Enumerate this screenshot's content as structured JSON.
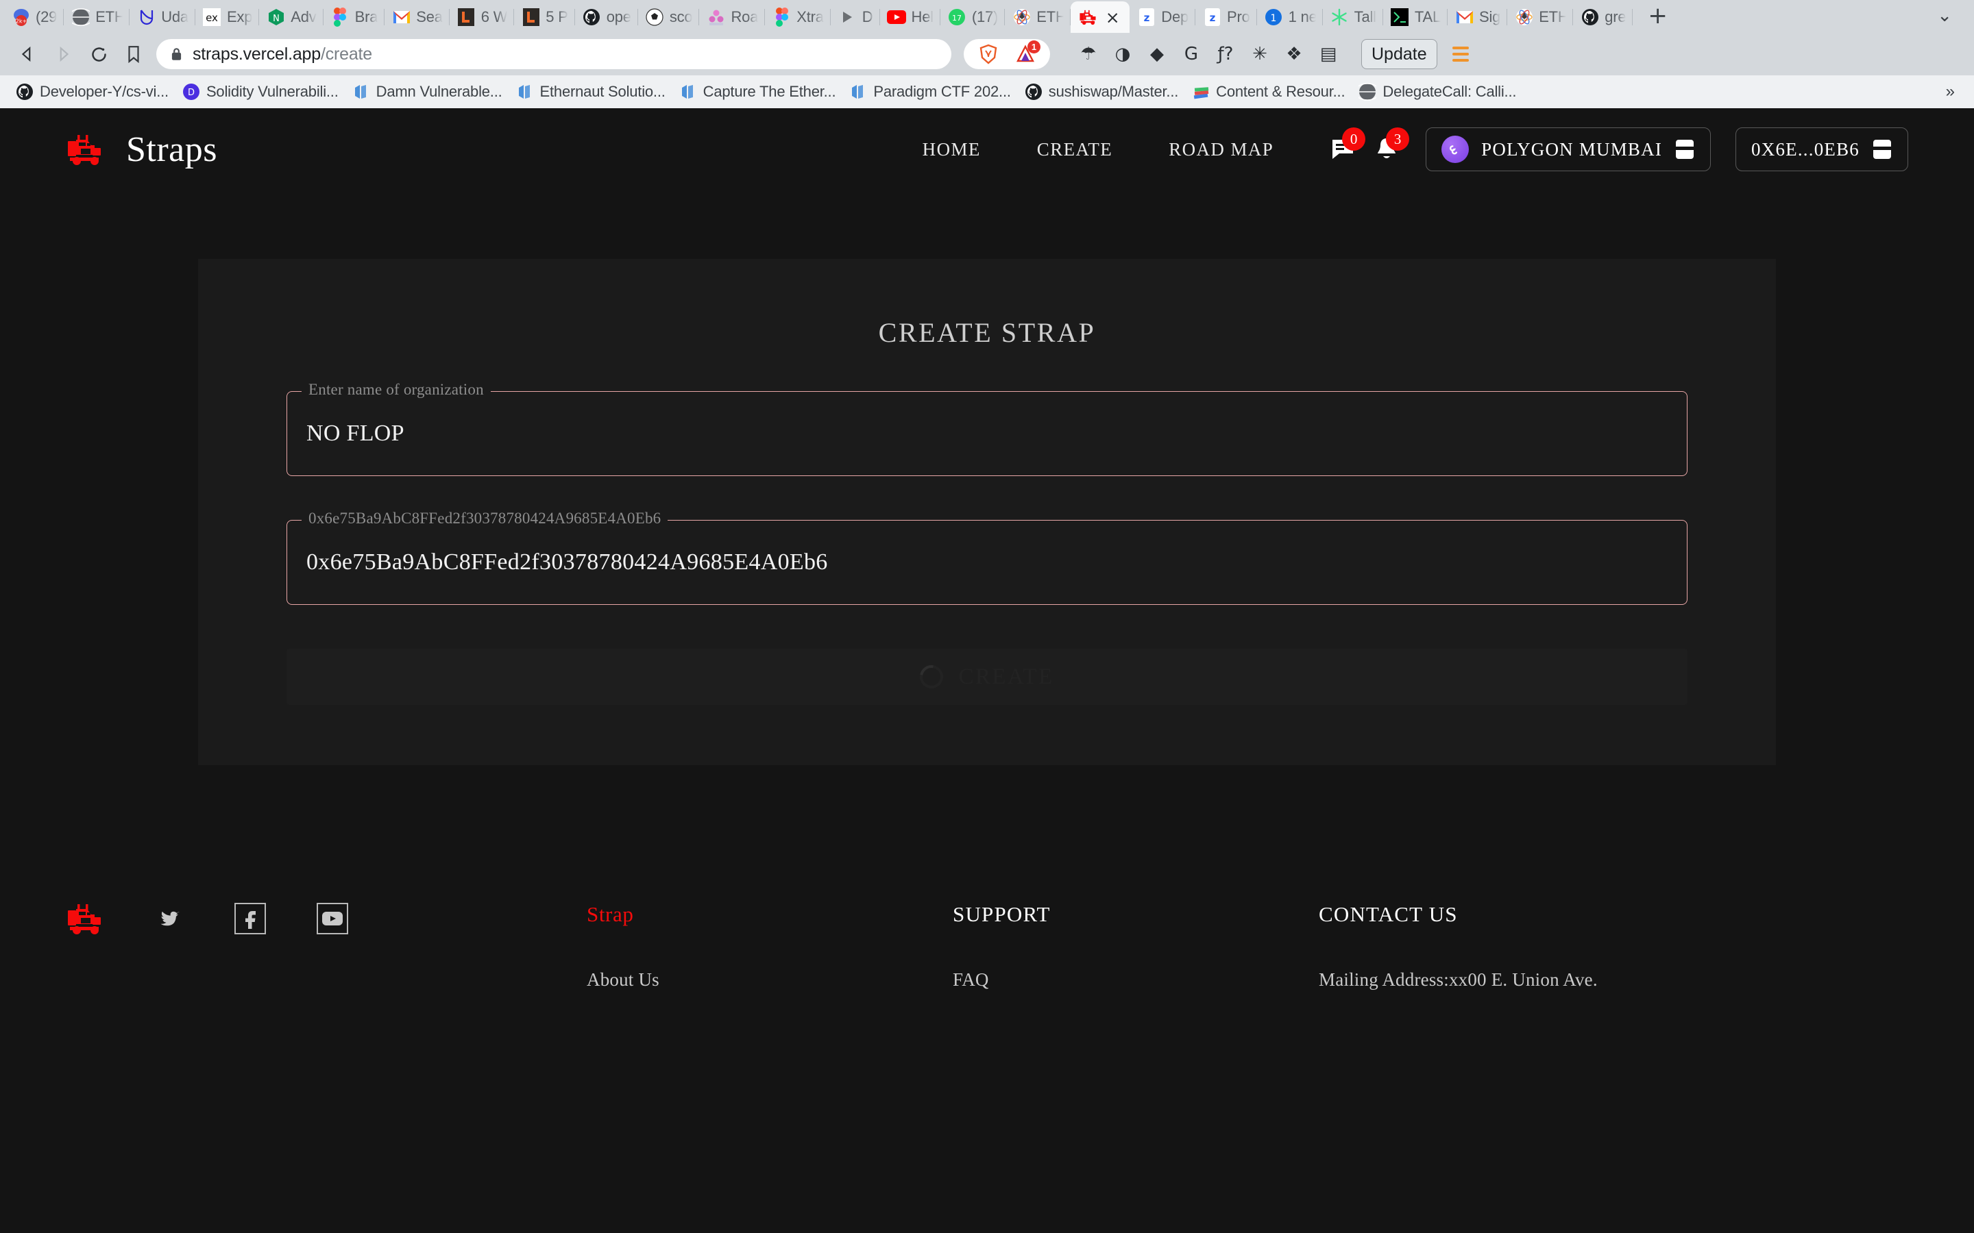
{
  "browser": {
    "tabs": [
      {
        "title": "(29",
        "icon": "reddit-badge-icon"
      },
      {
        "title": "ETH",
        "icon": "globe-icon"
      },
      {
        "title": "Uda",
        "icon": "udacity-icon"
      },
      {
        "title": "Exp",
        "icon": "ex-icon"
      },
      {
        "title": "Adv",
        "icon": "nextjs-icon"
      },
      {
        "title": "Bra",
        "icon": "figma-icon"
      },
      {
        "title": "Sea",
        "icon": "gmail-icon"
      },
      {
        "title": "6 W",
        "icon": "lever-icon"
      },
      {
        "title": "5 P",
        "icon": "lever-icon"
      },
      {
        "title": "ope",
        "icon": "github-icon"
      },
      {
        "title": "sco",
        "icon": "soccer-ball-icon"
      },
      {
        "title": "Roa",
        "icon": "people-icon"
      },
      {
        "title": "Xtra",
        "icon": "figma-icon"
      },
      {
        "title": "D",
        "icon": "play-icon"
      },
      {
        "title": "Hel",
        "icon": "youtube-icon"
      },
      {
        "title": "(17)",
        "icon": "whatsapp-icon"
      },
      {
        "title": "ETH",
        "icon": "ethereum-icon"
      },
      {
        "title": "",
        "icon": "straps-truck-icon",
        "active": true,
        "close": "×"
      },
      {
        "title": "Dep",
        "icon": "zerion-icon"
      },
      {
        "title": "Pro",
        "icon": "zerion-icon"
      },
      {
        "title": "1 ne",
        "icon": "number-one-icon"
      },
      {
        "title": "Tall",
        "icon": "asterisk-icon"
      },
      {
        "title": "TAL",
        "icon": "terminal-icon"
      },
      {
        "title": "Sig",
        "icon": "gmail-icon"
      },
      {
        "title": "ETH",
        "icon": "ethereum-icon"
      },
      {
        "title": "gre",
        "icon": "github-icon"
      }
    ],
    "new_tab_label": "+",
    "tab_list_label": "⌄",
    "toolbar": {
      "back_label": "◁",
      "forward_label": "▷",
      "reload_label": "⟳",
      "bookmark_label": "☐",
      "lock_label": "🔒",
      "url_host": "straps.vercel.app",
      "url_path": "/create",
      "brave_shield_label": "brave-lion",
      "brave_rewards_badge": "1",
      "extensions": [
        {
          "name": "rabby-wallet-icon",
          "glyph": "☂"
        },
        {
          "name": "phantom-wallet-icon",
          "glyph": "◑"
        },
        {
          "name": "metamask-icon",
          "glyph": "◆"
        },
        {
          "name": "google-translate-icon",
          "glyph": "G"
        },
        {
          "name": "fontsninja-icon",
          "glyph": "ƒ?"
        },
        {
          "name": "loading-spinner-icon",
          "glyph": "✳"
        },
        {
          "name": "extensions-puzzle-icon",
          "glyph": "❖"
        },
        {
          "name": "wallet-icon",
          "glyph": "▤"
        }
      ],
      "update_label": "Update",
      "menu_label": "hamburger-menu"
    },
    "bookmarks": [
      {
        "label": "Developer-Y/cs-vi...",
        "icon": "github-icon"
      },
      {
        "label": "Solidity Vulnerabili...",
        "icon": "letter-d-icon"
      },
      {
        "label": "Damn Vulnerable...",
        "icon": "openzeppelin-icon"
      },
      {
        "label": "Ethernaut Solutio...",
        "icon": "openzeppelin-icon"
      },
      {
        "label": "Capture The Ether...",
        "icon": "openzeppelin-icon"
      },
      {
        "label": "Paradigm CTF 202...",
        "icon": "openzeppelin-icon"
      },
      {
        "label": "sushiswap/Master...",
        "icon": "github-icon"
      },
      {
        "label": "Content & Resour...",
        "icon": "books-icon"
      },
      {
        "label": "DelegateCall: Calli...",
        "icon": "globe-icon"
      }
    ],
    "bookmarks_overflow_label": "»"
  },
  "site": {
    "brand": {
      "name": "Straps",
      "logo": "straps-truck-logo"
    },
    "nav": [
      {
        "label": "HOME"
      },
      {
        "label": "CREATE"
      },
      {
        "label": "ROAD MAP"
      }
    ],
    "header_icons": [
      {
        "name": "messages-icon",
        "badge": "0"
      },
      {
        "name": "notifications-bell-icon",
        "badge": "3"
      }
    ],
    "network_button": {
      "label": "POLYGON MUMBAI",
      "chain_icon": "polygon-icon",
      "wallet_icon": "wallet-card-icon"
    },
    "account_button": {
      "label": "0X6E...0EB6",
      "wallet_icon": "wallet-card-icon"
    },
    "colors": {
      "accent_red": "#f50b0b",
      "field_border": "#e8a6a6",
      "page_bg": "#141414",
      "card_bg": "#1b1b1b",
      "badge_red": "#f50b0b"
    }
  },
  "main": {
    "title": "CREATE STRAP",
    "fields": [
      {
        "name": "organization-name",
        "legend": "Enter name of organization",
        "value": "NO FLOP",
        "placeholder": "Enter name of organization"
      },
      {
        "name": "wallet-address",
        "legend": "0x6e75Ba9AbC8FFed2f30378780424A9685E4A0Eb6",
        "value": "0x6e75Ba9AbC8FFed2f30378780424A9685E4A0Eb6",
        "placeholder": "0x6e75Ba9AbC8FFed2f30378780424A9685E4A0Eb6"
      }
    ],
    "submit_label": "CREATE",
    "submit_state": "loading-disabled"
  },
  "footer": {
    "logo": "straps-truck-logo",
    "social": [
      {
        "name": "twitter-icon"
      },
      {
        "name": "facebook-icon"
      },
      {
        "name": "youtube-icon"
      }
    ],
    "columns": [
      {
        "title": "Strap",
        "accent": true,
        "items": [
          "About Us"
        ]
      },
      {
        "title": "SUPPORT",
        "accent": false,
        "items": [
          "FAQ"
        ]
      },
      {
        "title": "CONTACT US",
        "accent": false,
        "items": [
          "Mailing Address:xx00 E. Union Ave."
        ]
      }
    ]
  }
}
